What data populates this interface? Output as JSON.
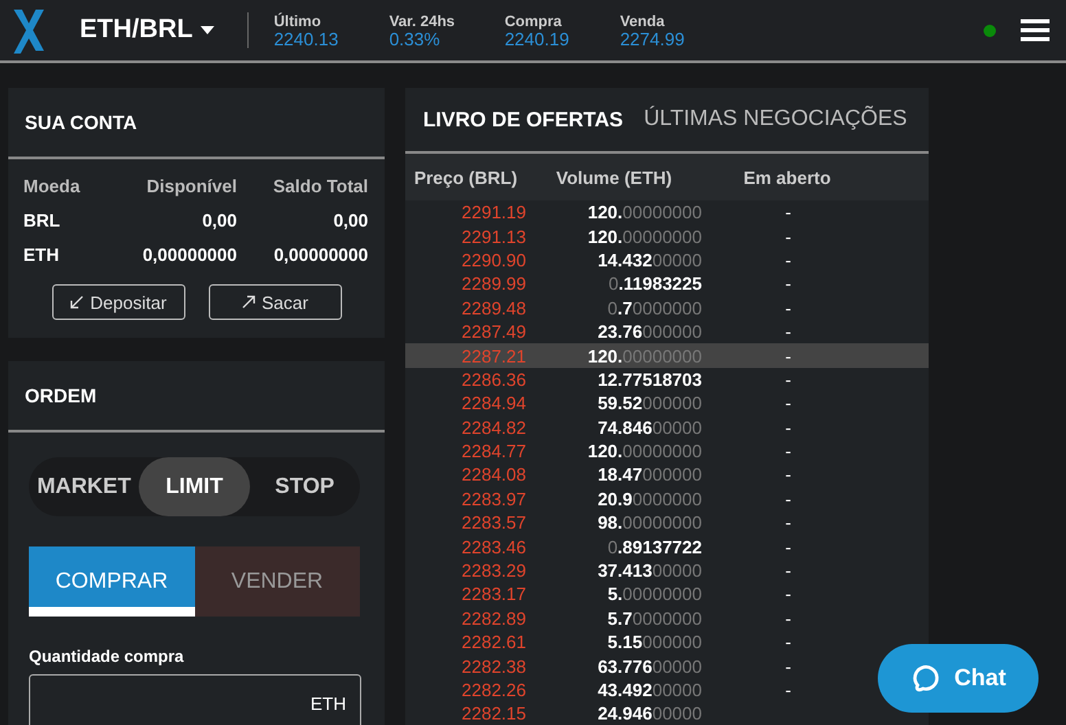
{
  "header": {
    "pair": "ETH/BRL",
    "stats": [
      {
        "label": "Último",
        "value": "2240.13"
      },
      {
        "label": "Var. 24hs",
        "value": "0.33%"
      },
      {
        "label": "Compra",
        "value": "2240.19"
      },
      {
        "label": "Venda",
        "value": "2274.99"
      }
    ],
    "online": true
  },
  "account": {
    "title": "SUA CONTA",
    "columns": [
      "Moeda",
      "Disponível",
      "Saldo Total"
    ],
    "rows": [
      {
        "currency": "BRL",
        "available": "0,00",
        "total": "0,00"
      },
      {
        "currency": "ETH",
        "available": "0,00000000",
        "total": "0,00000000"
      }
    ],
    "buttons": [
      {
        "kind": "deposit",
        "label": "Depositar"
      },
      {
        "kind": "withdraw",
        "label": "Sacar"
      }
    ]
  },
  "order": {
    "title": "ORDEM",
    "types": [
      {
        "label": "MARKET",
        "selected": false
      },
      {
        "label": "LIMIT",
        "selected": true
      },
      {
        "label": "STOP",
        "selected": false
      }
    ],
    "sides": [
      {
        "kind": "buy",
        "label": "COMPRAR",
        "selected": true
      },
      {
        "kind": "sell",
        "label": "VENDER",
        "selected": false
      }
    ],
    "quantity": {
      "label": "Quantidade compra",
      "unit": "ETH"
    }
  },
  "book": {
    "tabs": [
      {
        "label": "LIVRO DE OFERTAS",
        "selected": true
      },
      {
        "label": "ÚLTIMAS NEGOCIAÇÕES",
        "selected": false
      }
    ],
    "columns": [
      "Preço (BRL)",
      "Volume (ETH)",
      "Em aberto"
    ],
    "rows": [
      {
        "price": "2291.19",
        "volume": "**120.**00000000",
        "open": "-",
        "selected": false
      },
      {
        "price": "2291.13",
        "volume": "**120.**00000000",
        "open": "-",
        "selected": false
      },
      {
        "price": "2290.90",
        "volume": "**14.432**00000",
        "open": "-",
        "selected": false
      },
      {
        "price": "2289.99",
        "volume": "0**.11983225**",
        "open": "-",
        "selected": false
      },
      {
        "price": "2289.48",
        "volume": "0**.7**0000000",
        "open": "-",
        "selected": false
      },
      {
        "price": "2287.49",
        "volume": "**23.76**000000",
        "open": "-",
        "selected": false
      },
      {
        "price": "2287.21",
        "volume": "**120.**00000000",
        "open": "-",
        "selected": true
      },
      {
        "price": "2286.36",
        "volume": "**12.77518703**",
        "open": "-",
        "selected": false
      },
      {
        "price": "2284.94",
        "volume": "**59.52**000000",
        "open": "-",
        "selected": false
      },
      {
        "price": "2284.82",
        "volume": "**74.846**00000",
        "open": "-",
        "selected": false
      },
      {
        "price": "2284.77",
        "volume": "**120.**00000000",
        "open": "-",
        "selected": false
      },
      {
        "price": "2284.08",
        "volume": "**18.47**000000",
        "open": "-",
        "selected": false
      },
      {
        "price": "2283.97",
        "volume": "**20.9**0000000",
        "open": "-",
        "selected": false
      },
      {
        "price": "2283.57",
        "volume": "**98.**00000000",
        "open": "-",
        "selected": false
      },
      {
        "price": "2283.46",
        "volume": "0**.89137722**",
        "open": "-",
        "selected": false
      },
      {
        "price": "2283.29",
        "volume": "**37.413**00000",
        "open": "-",
        "selected": false
      },
      {
        "price": "2283.17",
        "volume": "**5.**00000000",
        "open": "-",
        "selected": false
      },
      {
        "price": "2282.89",
        "volume": "**5.7**0000000",
        "open": "-",
        "selected": false
      },
      {
        "price": "2282.61",
        "volume": "**5.15**000000",
        "open": "-",
        "selected": false
      },
      {
        "price": "2282.38",
        "volume": "**63.776**00000",
        "open": "-",
        "selected": false
      },
      {
        "price": "2282.26",
        "volume": "**43.492**00000",
        "open": "-",
        "selected": false
      },
      {
        "price": "2282.15",
        "volume": "**24.946**00000",
        "open": "",
        "selected": false
      }
    ]
  },
  "chat": {
    "label": "Chat"
  }
}
